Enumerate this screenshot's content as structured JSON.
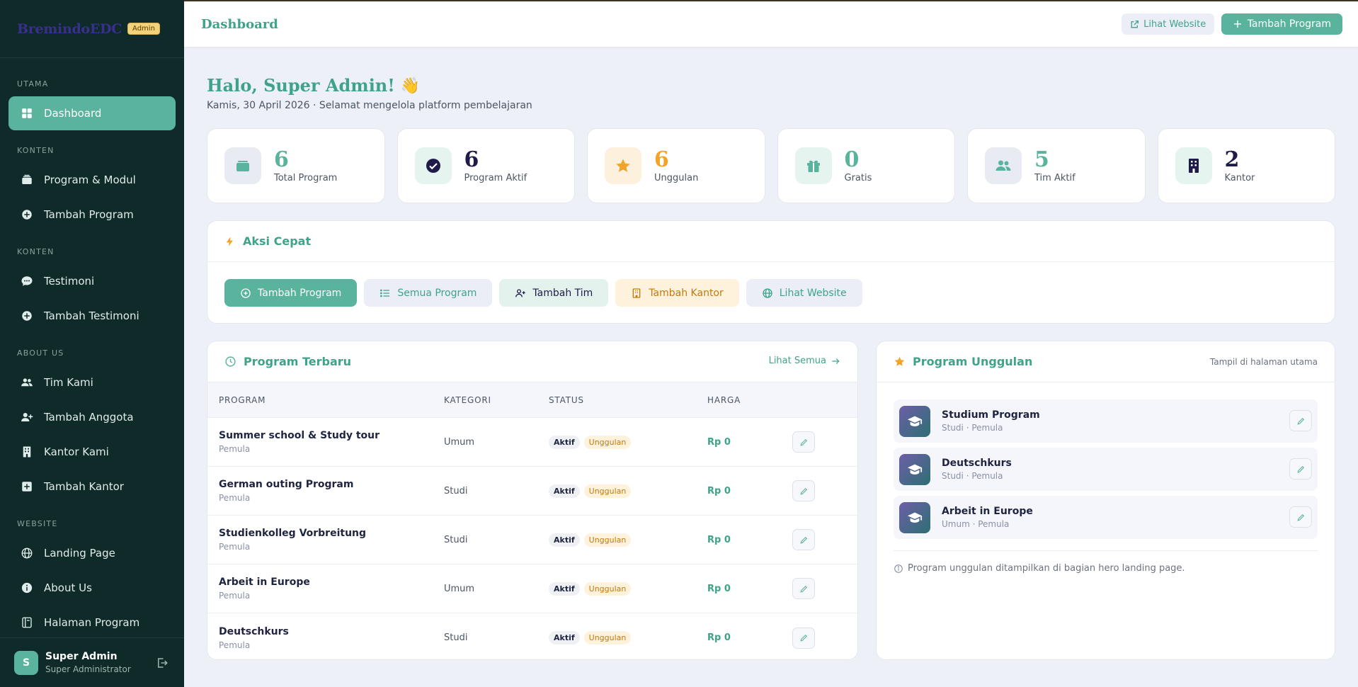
{
  "sidebar": {
    "brand": "BremindoEDC",
    "badge": "Admin",
    "sections": {
      "s1": "UTAMA",
      "s2": "KONTEN",
      "s3": "KONTEN",
      "s4": "ABOUT US",
      "s5": "WEBSITE"
    },
    "items": {
      "dashboard": "Dashboard",
      "program_modul": "Program & Modul",
      "tambah_program": "Tambah Program",
      "testimoni": "Testimoni",
      "tambah_testimoni": "Tambah Testimoni",
      "tim_kami": "Tim Kami",
      "tambah_anggota": "Tambah Anggota",
      "kantor_kami": "Kantor Kami",
      "tambah_kantor": "Tambah Kantor",
      "landing_page": "Landing Page",
      "about_us": "About Us",
      "halaman_program": "Halaman Program"
    },
    "user": {
      "initial": "S",
      "name": "Super Admin",
      "role": "Super Administrator"
    }
  },
  "header": {
    "title": "Dashboard",
    "view_site": "Lihat Website",
    "add_program": "Tambah Program"
  },
  "greeting": {
    "title": "Halo, Super Admin!",
    "emoji": "👋",
    "subtitle": "Kamis, 30 April 2026 · Selamat mengelola platform pembelajaran"
  },
  "stats": [
    {
      "value": "6",
      "label": "Total Program",
      "color": "#5ab39c"
    },
    {
      "value": "6",
      "label": "Program Aktif",
      "color": "#1e1b4b"
    },
    {
      "value": "6",
      "label": "Unggulan",
      "color": "#f2a42a"
    },
    {
      "value": "0",
      "label": "Gratis",
      "color": "#5ab39c"
    },
    {
      "value": "5",
      "label": "Tim Aktif",
      "color": "#5ab39c"
    },
    {
      "value": "2",
      "label": "Kantor",
      "color": "#1e1b4b"
    }
  ],
  "quick": {
    "title": "Aksi Cepat",
    "buttons": [
      "Tambah Program",
      "Semua Program",
      "Tambah Tim",
      "Tambah Kantor",
      "Lihat Website"
    ]
  },
  "recent": {
    "title": "Program Terbaru",
    "see_all": "Lihat Semua",
    "columns": [
      "PROGRAM",
      "KATEGORI",
      "STATUS",
      "HARGA"
    ],
    "rows": [
      {
        "name": "Summer school & Study tour",
        "level": "Pemula",
        "category": "Umum",
        "status": "Aktif",
        "tag": "Unggulan",
        "price": "Rp 0"
      },
      {
        "name": "German outing Program",
        "level": "Pemula",
        "category": "Studi",
        "status": "Aktif",
        "tag": "Unggulan",
        "price": "Rp 0"
      },
      {
        "name": "Studienkolleg Vorbreitung",
        "level": "Pemula",
        "category": "Studi",
        "status": "Aktif",
        "tag": "Unggulan",
        "price": "Rp 0"
      },
      {
        "name": "Arbeit in Europe",
        "level": "Pemula",
        "category": "Umum",
        "status": "Aktif",
        "tag": "Unggulan",
        "price": "Rp 0"
      },
      {
        "name": "Deutschkurs",
        "level": "Pemula",
        "category": "Studi",
        "status": "Aktif",
        "tag": "Unggulan",
        "price": "Rp 0"
      }
    ]
  },
  "featured": {
    "title": "Program Unggulan",
    "hint": "Tampil di halaman utama",
    "items": [
      {
        "name": "Studium Program",
        "meta": "Studi · Pemula"
      },
      {
        "name": "Deutschkurs",
        "meta": "Studi · Pemula"
      },
      {
        "name": "Arbeit in Europe",
        "meta": "Umum · Pemula"
      }
    ],
    "note": "Program unggulan ditampilkan di bagian hero landing page."
  },
  "colors": {
    "accent": "#5ab39c",
    "sidebar": "#0e2b2a",
    "navy": "#1e1b4b",
    "orange": "#f2a42a"
  }
}
